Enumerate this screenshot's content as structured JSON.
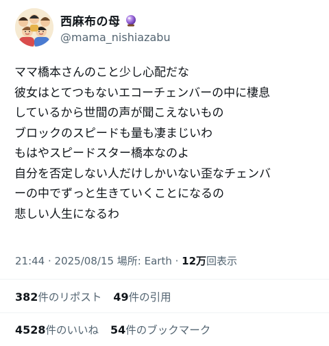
{
  "author": {
    "display_name": "西麻布の母",
    "badge_icon": "crystal-ball-icon",
    "handle": "@mama_nishiazabu"
  },
  "tweet": {
    "lines": [
      "ママ橋本さんのこと少し心配だな",
      "彼女はとてつもないエコーチェンバーの中に棲息",
      "しているから世間の声が聞こえないもの",
      "ブロックのスピードも量も凄まじいわ",
      "もはやスピードスター橋本なのよ",
      "自分を否定しない人だけしかいない歪なチェンバ",
      "ーの中でずっと生きていくことになるの",
      "悲しい人生になるわ"
    ]
  },
  "meta": {
    "time": "21:44",
    "separator": " · ",
    "date": "2025/08/15",
    "location_label": "場所: ",
    "location": "Earth",
    "views_count": "12万",
    "views_label": "回表示"
  },
  "stats": {
    "reposts_count": "382",
    "reposts_label": "件のリポスト",
    "quotes_count": "49",
    "quotes_label": "件の引用",
    "likes_count": "4528",
    "likes_label": "件のいいね",
    "bookmarks_count": "54",
    "bookmarks_label": "件のブックマーク"
  },
  "colors": {
    "text_primary": "#0f1419",
    "text_secondary": "#536471",
    "divider": "#eff3f4",
    "badge_purple": "#7b4fc7"
  }
}
